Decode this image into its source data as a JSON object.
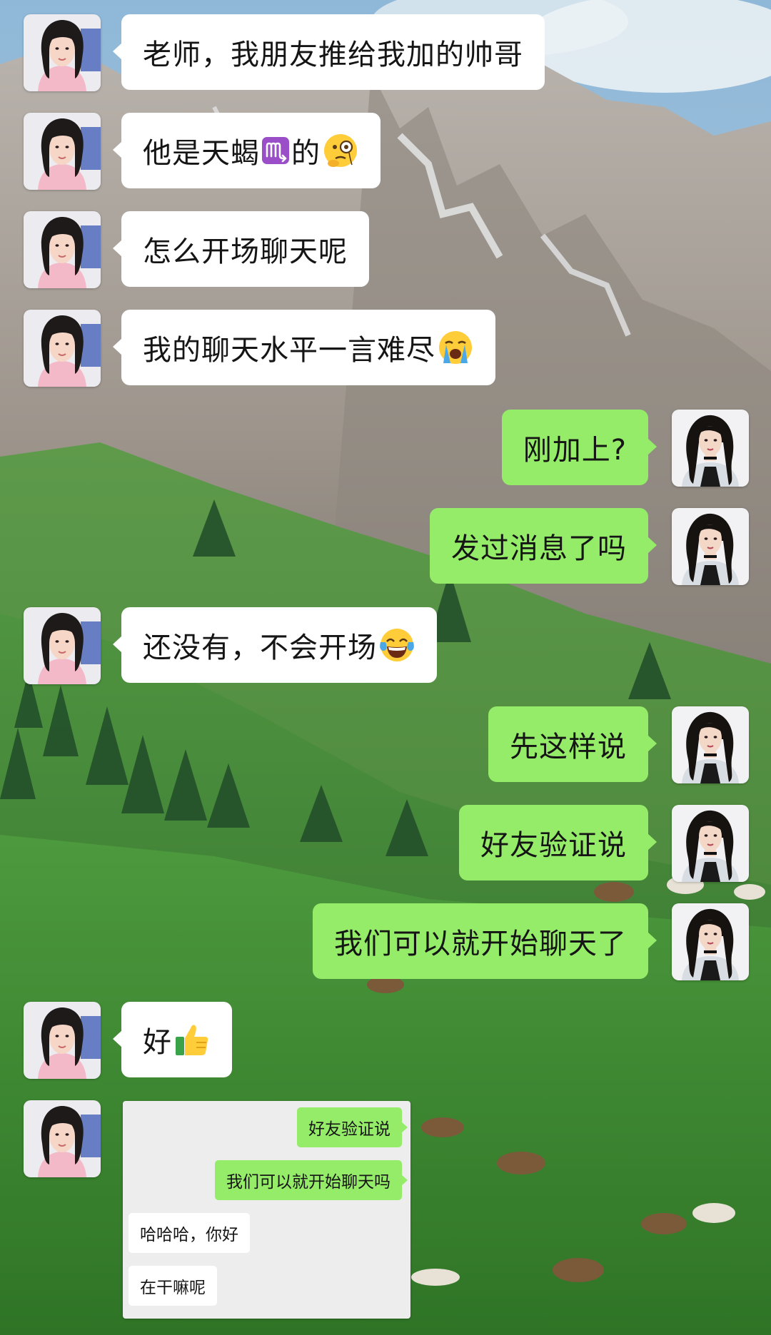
{
  "colors": {
    "sent_bubble": "#95ec69",
    "received_bubble": "#ffffff",
    "screenshot_bg": "#ededed"
  },
  "avatars": {
    "student": "young-woman-avatar",
    "teacher": "woman-in-suit-avatar"
  },
  "messages": [
    {
      "side": "left",
      "text": "老师，我朋友推给我加的帅哥"
    },
    {
      "side": "left",
      "text_before": "他是天蝎",
      "icon": "scorpio-sign-icon",
      "text_after": "的",
      "emoji": "monocle-face-emoji"
    },
    {
      "side": "left",
      "text": "怎么开场聊天呢"
    },
    {
      "side": "left",
      "text": "我的聊天水平一言难尽",
      "emoji": "loudly-crying-emoji"
    },
    {
      "side": "right",
      "text": "刚加上?"
    },
    {
      "side": "right",
      "text": "发过消息了吗"
    },
    {
      "side": "left",
      "text": "还没有，不会开场",
      "emoji": "tears-of-joy-emoji"
    },
    {
      "side": "right",
      "text": "先这样说"
    },
    {
      "side": "right",
      "text": "好友验证说"
    },
    {
      "side": "right",
      "text": "我们可以就开始聊天了"
    },
    {
      "side": "left",
      "text": "好",
      "emoji": "thumbs-up-emoji"
    }
  ],
  "screenshot": {
    "lines": [
      {
        "side": "right",
        "text": "好友验证说"
      },
      {
        "side": "right",
        "text": "我们可以就开始聊天吗"
      },
      {
        "side": "left",
        "text": "哈哈哈，你好"
      },
      {
        "side": "left",
        "text": "在干嘛呢"
      }
    ]
  }
}
